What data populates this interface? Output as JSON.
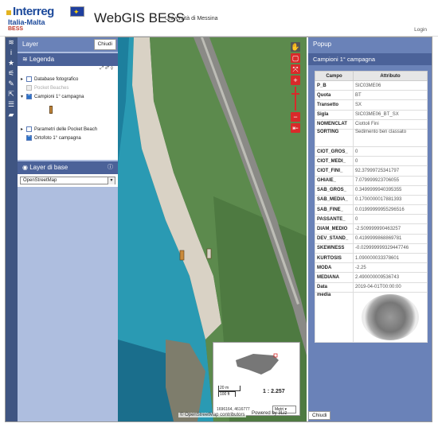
{
  "header": {
    "logo_main": "Interreg",
    "logo_sub": "Italia-Malta",
    "logo_project": "BESS",
    "app_title": "WebGIS BESS",
    "app_subtitle": "Università di Messina",
    "login_label": "Login"
  },
  "left_panel": {
    "title": "Layer",
    "close_label": "Chiudi",
    "legend_title": "Legenda",
    "tree": [
      {
        "label": "Database fotografico",
        "checked": false,
        "dim": false
      },
      {
        "label": "Pocket Beaches",
        "checked": false,
        "dim": true
      },
      {
        "label": "Campioni 1° campagna",
        "checked": true,
        "dim": false
      }
    ],
    "tree2": [
      {
        "label": "Parametri delle Pocket Beach",
        "checked": false
      },
      {
        "label": "Ortofoto 1° campagna",
        "checked": true
      }
    ],
    "base_title": "Layer di base",
    "base_select": "OpenStreetMap"
  },
  "map": {
    "scale_top": "20 m",
    "scale_bottom": "100 ft",
    "scale_ratio": "1 : 2.257",
    "coords": "1696164, 4616777",
    "unit": "Metri",
    "attribution": "© OpenStreetMap contributors",
    "powered_by": "Powered by 3Liz"
  },
  "right_panel": {
    "title": "Popup",
    "subtitle": "Campioni 1° campagna",
    "col_field": "Campo",
    "col_attr": "Attributo",
    "rows": [
      [
        "P_B",
        "SIC03ME06"
      ],
      [
        "Quota",
        "BT"
      ],
      [
        "Transetto",
        "SX"
      ],
      [
        "Sigla",
        "SIC03ME06_BT_SX"
      ],
      [
        "NOMENCLAT",
        "Ciottoli Fini"
      ],
      [
        "SORTING",
        "Sedimento ben classato"
      ],
      [
        "CIOT_GROS_",
        "0"
      ],
      [
        "CIOT_MEDI_",
        "0"
      ],
      [
        "CIOT_FINI_",
        "92.37999725341797"
      ],
      [
        "GHIAIE_",
        "7.079999923706055"
      ],
      [
        "SAB_GROS_",
        "0.3499999940395355"
      ],
      [
        "SAB_MEDIA_",
        "0.1700000017881393"
      ],
      [
        "SAB_FINE_",
        "0.01999999955296516"
      ],
      [
        "PASSANTE_",
        "0"
      ],
      [
        "DIAM_MEDIO",
        "-2.509999990463257"
      ],
      [
        "DEV_STAND_",
        "0.4199999868869781"
      ],
      [
        "SKEWNESS",
        "-0.029999999329447746"
      ],
      [
        "KURTOSIS",
        "1.090000033378601"
      ],
      [
        "MODA",
        "-2.25"
      ],
      [
        "MEDIANA",
        "2.490000009536743"
      ],
      [
        "Data",
        "2019-04-01T00:00:00"
      ]
    ],
    "media_label": "media",
    "close_label": "Chiudi"
  }
}
